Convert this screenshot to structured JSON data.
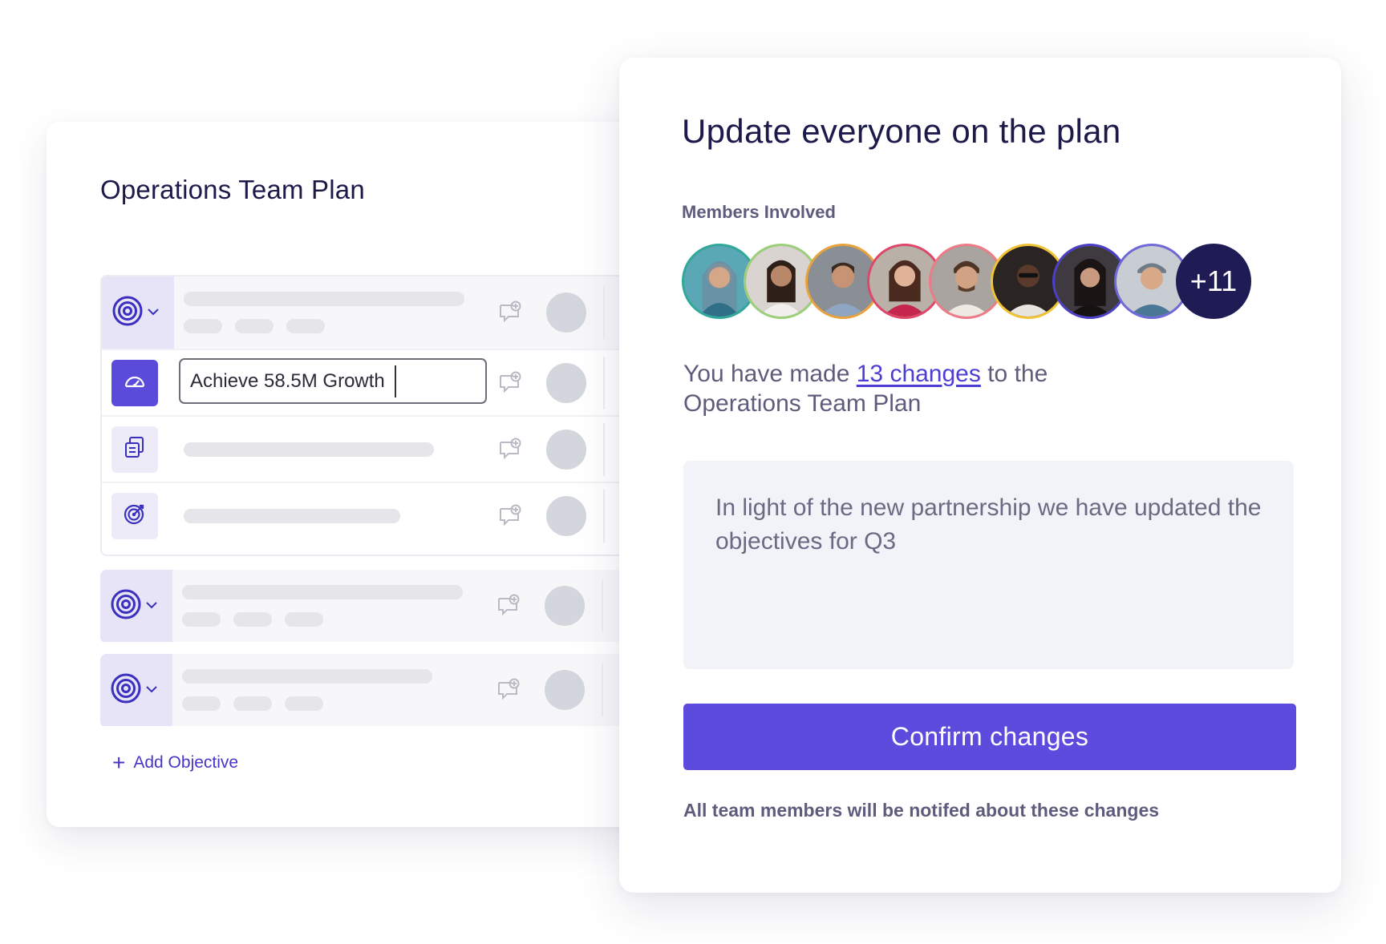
{
  "plan": {
    "title": "Operations Team Plan",
    "key_result_value": "Achieve 58.5M Growth",
    "add_objective_label": "Add Objective"
  },
  "update": {
    "title": "Update everyone on the plan",
    "members_label": "Members Involved",
    "more_members": "+11",
    "changes_prefix": "You have made ",
    "changes_link": "13 changes",
    "changes_suffix": " to the Operations Team Plan",
    "message": "In light of the new partnership we have updated the objectives for Q3",
    "confirm_label": "Confirm changes",
    "notice": "All team members will be notifed about these changes"
  },
  "colors": {
    "accent": "#5c4bdd",
    "navy": "#1f1b55",
    "avatar_rings": [
      "#2fa89a",
      "#9ccf7a",
      "#e9a33d",
      "#e0456a",
      "#ef7b86",
      "#f1c232",
      "#4b3fc7",
      "#6f68d8"
    ]
  },
  "icons": {
    "objective": "target-icon",
    "key_result": "gauge-icon",
    "task": "document-stack-icon",
    "goal": "dartboard-icon",
    "comment": "comment-add-icon"
  }
}
